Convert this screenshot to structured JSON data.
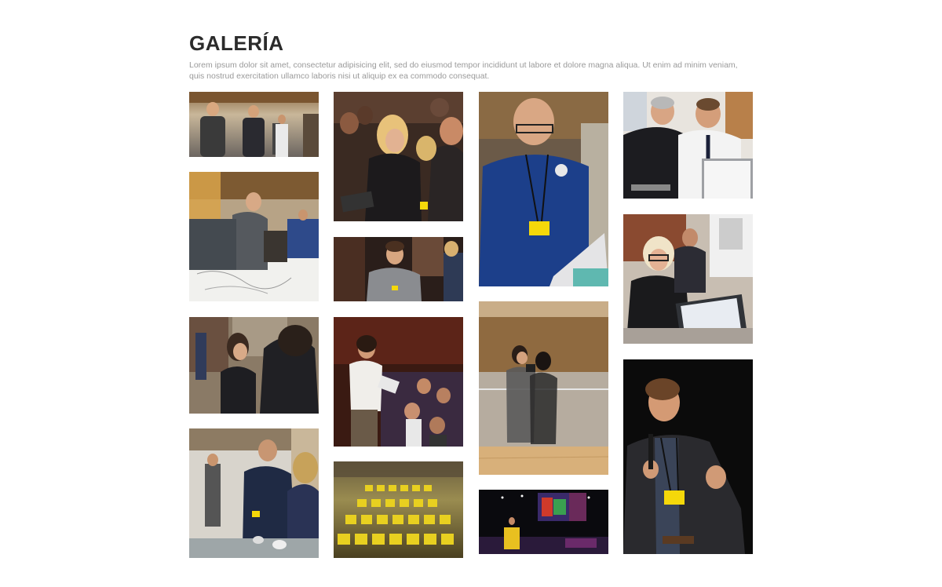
{
  "gallery": {
    "title": "GALERÍA",
    "description": "Lorem ipsum dolor sit amet, consectetur adipisicing elit, sed do eiusmod tempor incididunt ut labore et dolore magna aliqua. Ut enim ad minim veniam, quis nostrud exercitation ullamco laboris nisi ut aliquip ex ea commodo consequat."
  }
}
